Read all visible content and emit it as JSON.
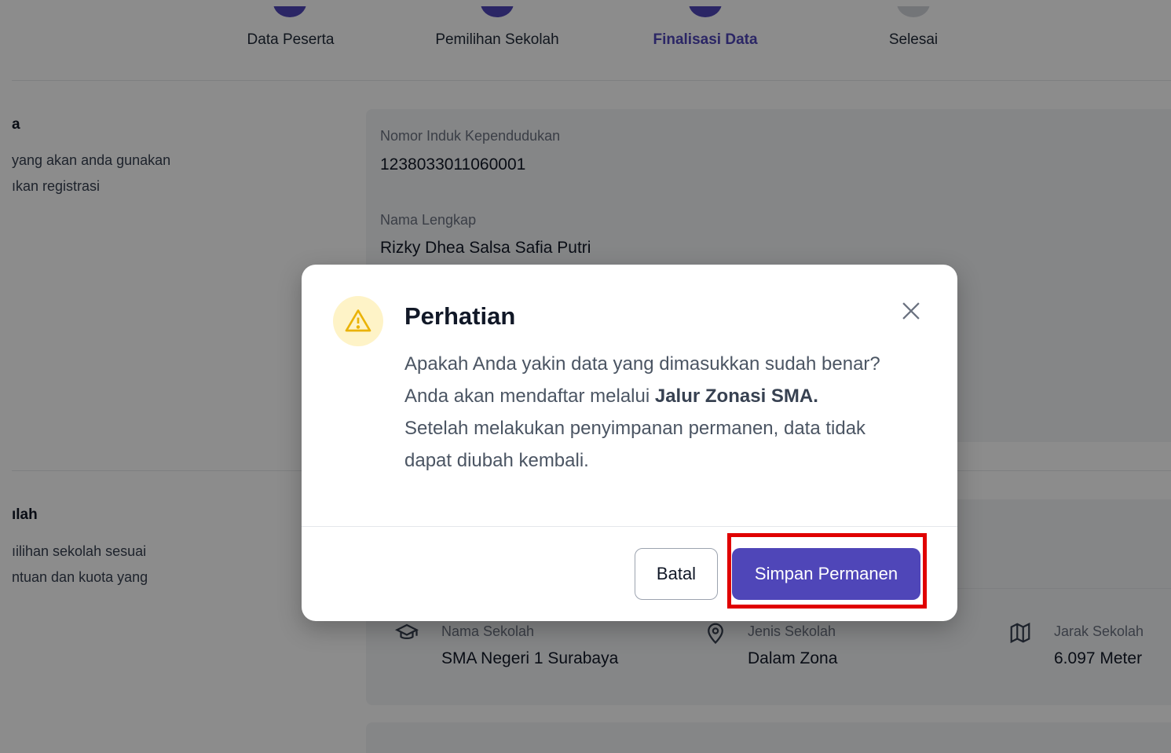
{
  "stepper": {
    "steps": [
      {
        "label": "Data Peserta",
        "state": "done"
      },
      {
        "label": "Pemilihan Sekolah",
        "state": "done"
      },
      {
        "label": "Finalisasi Data",
        "state": "active"
      },
      {
        "label": "Selesai",
        "state": "pending"
      }
    ]
  },
  "section1": {
    "title": "a",
    "desc_line1": "yang akan anda gunakan",
    "desc_line2": "ıkan registrasi"
  },
  "identity": {
    "nik_label": "Nomor Induk Kependudukan",
    "nik_value": "1238033011060001",
    "name_label": "Nama Lengkap",
    "name_value": "Rizky Dhea Salsa Safia Putri"
  },
  "section2": {
    "title": "ılah",
    "desc_line1": "ıilihan sekolah sesuai",
    "desc_line2": "ntuan dan kuota yang"
  },
  "school": {
    "name_label": "Nama Sekolah",
    "name_value": "SMA Negeri 1 Surabaya",
    "type_label": "Jenis Sekolah",
    "type_value": "Dalam Zona",
    "distance_label": "Jarak Sekolah",
    "distance_value": "6.097 Meter"
  },
  "modal": {
    "title": "Perhatian",
    "line1": "Apakah Anda yakin data yang dimasukkan sudah benar?",
    "line2_prefix": "Anda akan mendaftar melalui ",
    "line2_bold": "Jalur Zonasi SMA.",
    "line3": "Setelah melakukan penyimpanan permanen, data tidak",
    "line4": "dapat diubah kembali.",
    "cancel_label": "Batal",
    "confirm_label": "Simpan Permanen",
    "icon": "warning-icon",
    "close_icon": "close-icon"
  },
  "colors": {
    "primary": "#4f46b8",
    "warning_bg": "#fef3c7",
    "warning_icon": "#eab308",
    "highlight": "#e00000"
  }
}
